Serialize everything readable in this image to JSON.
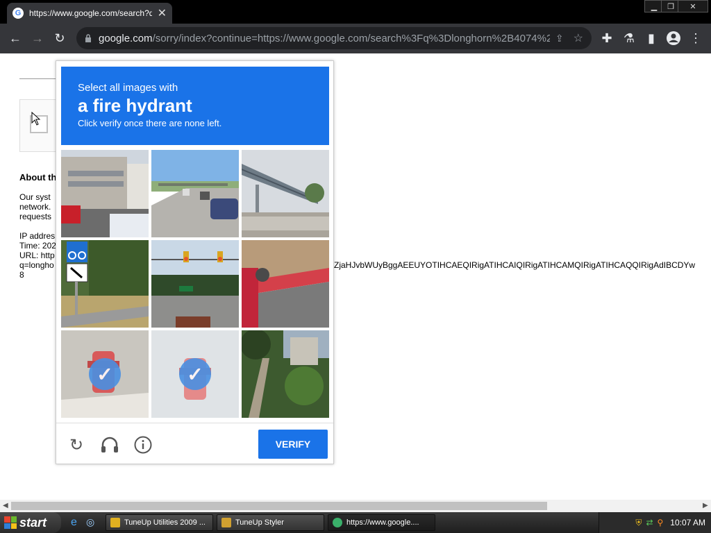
{
  "browser": {
    "tab_title": "https://www.google.com/search?q=",
    "tab_favicon": "G",
    "url_host": "google.com",
    "url_rest": "/sorry/index?continue=https://www.google.com/search%3Fq%3Dlonghorn%2B4074%2..."
  },
  "page": {
    "about_heading": "About th",
    "line1": "Our syst",
    "line2": "network.",
    "line3": "requests",
    "ip_label": "IP addres",
    "time_label": "Time: 202",
    "url_label": "URL: http",
    "q_label": "q=longho",
    "q_tail": "8",
    "long_param": "ZjaHJvbWUyBggAEEUYOTIHCAEQIRigATIHCAIQIRigATIHCAMQIRigATIHCAQQIRigAdIBCDYw"
  },
  "captcha": {
    "instruction_line1": "Select all images with",
    "target_object": "a fire hydrant",
    "instruction_line3": "Click verify once there are none left.",
    "verify_label": "VERIFY",
    "check_glyph": "✓",
    "tiles": [
      {
        "desc": "building-street",
        "selected": false
      },
      {
        "desc": "highway-cars",
        "selected": false
      },
      {
        "desc": "pedestrian-bridge",
        "selected": false
      },
      {
        "desc": "bike-sign",
        "selected": false
      },
      {
        "desc": "traffic-lights",
        "selected": false
      },
      {
        "desc": "curb-road",
        "selected": false
      },
      {
        "desc": "hydrant-selected-1",
        "selected": true
      },
      {
        "desc": "hydrant-selected-2",
        "selected": true
      },
      {
        "desc": "stairs-trees",
        "selected": false
      }
    ]
  },
  "taskbar": {
    "start_label": "start",
    "items": [
      {
        "label": "TuneUp Utilities 2009 ..."
      },
      {
        "label": "TuneUp Styler"
      },
      {
        "label": "https://www.google...."
      }
    ],
    "clock": "10:07 AM"
  }
}
